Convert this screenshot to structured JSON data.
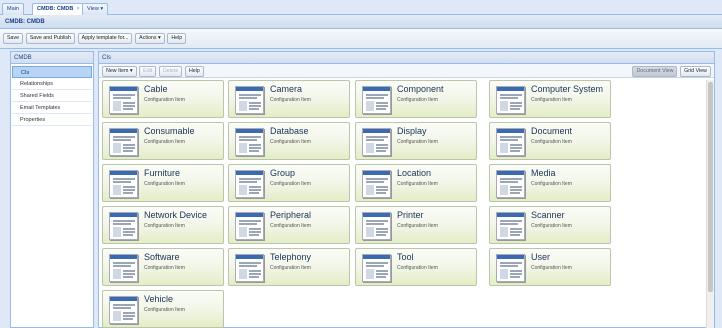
{
  "tabs": [
    {
      "label": "Main"
    },
    {
      "label": "CMDB: CMDB",
      "close": "×"
    },
    {
      "label": "View ▾"
    }
  ],
  "window_title": "CMDB: CMDB",
  "toolbar": {
    "save": "Save",
    "save_publish": "Save and Publish",
    "apply_template": "Apply template for...",
    "actions": "Actions ▾",
    "help": "Help"
  },
  "sidebar": {
    "title": "CMDB",
    "items": [
      {
        "label": "CIs"
      },
      {
        "label": "Relationships"
      },
      {
        "label": "Shared Fields"
      },
      {
        "label": "Email Templates"
      },
      {
        "label": "Properties"
      }
    ]
  },
  "main": {
    "title": "CIs",
    "new_item": "New Item ▾",
    "edit": "Edit",
    "delete": "Delete",
    "help": "Help",
    "document_view": "Document View",
    "grid_view": "Grid View"
  },
  "cards": [
    {
      "title": "Cable",
      "subtitle": "Configuration Item"
    },
    {
      "title": "Camera",
      "subtitle": "Configuration Item"
    },
    {
      "title": "Component",
      "subtitle": "Configuration Item"
    },
    {
      "title": "Computer System",
      "subtitle": "Configuration Item"
    },
    {
      "title": "Consumable",
      "subtitle": "Configuration Item"
    },
    {
      "title": "Database",
      "subtitle": "Configuration Item"
    },
    {
      "title": "Display",
      "subtitle": "Configuration Item"
    },
    {
      "title": "Document",
      "subtitle": "Configuration Item"
    },
    {
      "title": "Furniture",
      "subtitle": "Configuration Item"
    },
    {
      "title": "Group",
      "subtitle": "Configuration Item"
    },
    {
      "title": "Location",
      "subtitle": "Configuration Item"
    },
    {
      "title": "Media",
      "subtitle": "Configuration Item"
    },
    {
      "title": "Network Device",
      "subtitle": "Configuration Item"
    },
    {
      "title": "Peripheral",
      "subtitle": "Configuration Item"
    },
    {
      "title": "Printer",
      "subtitle": "Configuration Item"
    },
    {
      "title": "Scanner",
      "subtitle": "Configuration Item"
    },
    {
      "title": "Software",
      "subtitle": "Configuration Item"
    },
    {
      "title": "Telephony",
      "subtitle": "Configuration Item"
    },
    {
      "title": "Tool",
      "subtitle": "Configuration Item"
    },
    {
      "title": "User",
      "subtitle": "Configuration Item"
    },
    {
      "title": "Vehicle",
      "subtitle": "Configuration Item"
    }
  ]
}
